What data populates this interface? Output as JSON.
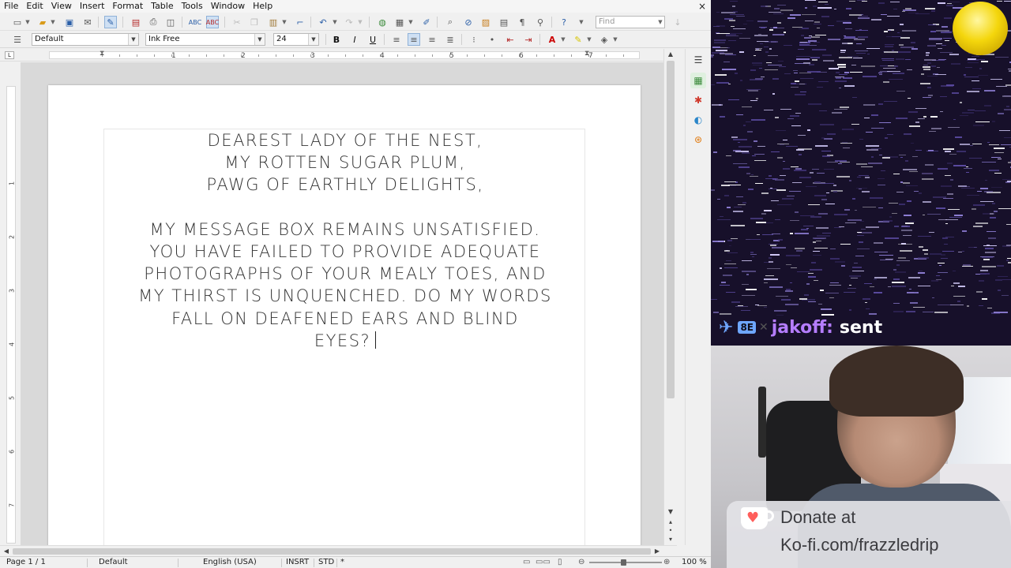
{
  "menubar": {
    "items": [
      "File",
      "Edit",
      "View",
      "Insert",
      "Format",
      "Table",
      "Tools",
      "Window",
      "Help"
    ],
    "close_glyph": "×"
  },
  "toolbar": {
    "find_placeholder": "Find",
    "icons": [
      "new-icon",
      "open-icon",
      "save-icon",
      "email-icon",
      "edit-mode-icon",
      "export-pdf-icon",
      "print-icon",
      "print-preview-icon",
      "spellcheck-icon",
      "autospell-icon",
      "cut-icon",
      "copy-icon",
      "paste-icon",
      "clone-format-icon",
      "undo-icon",
      "redo-icon",
      "hyperlink-icon",
      "table-icon",
      "show-draw-icon",
      "find-replace-icon",
      "navigator-icon",
      "gallery-icon",
      "datasources-icon",
      "nonprinting-chars-icon",
      "zoom-icon",
      "help-icon"
    ]
  },
  "formatting": {
    "paragraph_style": "Default",
    "font_name": "Ink Free",
    "font_size": "24",
    "bold": "B",
    "italic": "I",
    "underline": "U"
  },
  "ruler": {
    "numbers": [
      "1",
      "2",
      "3",
      "4",
      "5",
      "6",
      "7"
    ],
    "vertical_numbers": [
      "1",
      "2",
      "3",
      "4",
      "5",
      "6",
      "7"
    ]
  },
  "document": {
    "lines": [
      "DEAREST LADY OF THE NEST,",
      "MY ROTTEN SUGAR PLUM,",
      "PAWG OF EARTHLY DELIGHTS,",
      "",
      "MY MESSAGE BOX REMAINS UNSATISFIED.",
      "YOU HAVE FAILED TO PROVIDE ADEQUATE",
      "PHOTOGRAPHS OF YOUR MEALY TOES, AND",
      "MY THIRST IS UNQUENCHED. DO MY WORDS",
      "FALL ON DEAFENED EARS AND BLIND",
      "EYES?"
    ]
  },
  "statusbar": {
    "page": "Page 1 / 1",
    "page_style": "Default",
    "language": "English (USA)",
    "insert_mode": "INSRT",
    "selection_mode": "STD",
    "signature": "*",
    "zoom": "100 %"
  },
  "stream": {
    "chat": {
      "badge_sword": "✈",
      "badge_text": "8E",
      "badge_extra": "✕",
      "username": "jakoff",
      "colon": ":",
      "message": "sent"
    },
    "kofi": {
      "line1": "Donate at",
      "line2": "Ko-fi.com/frazzledrip"
    }
  },
  "colors": {
    "chat_username": "#b57dff",
    "chat_badge": "#6ea6ff",
    "kofi_heart": "#ff5e5b",
    "moon": "#f4d60c"
  }
}
